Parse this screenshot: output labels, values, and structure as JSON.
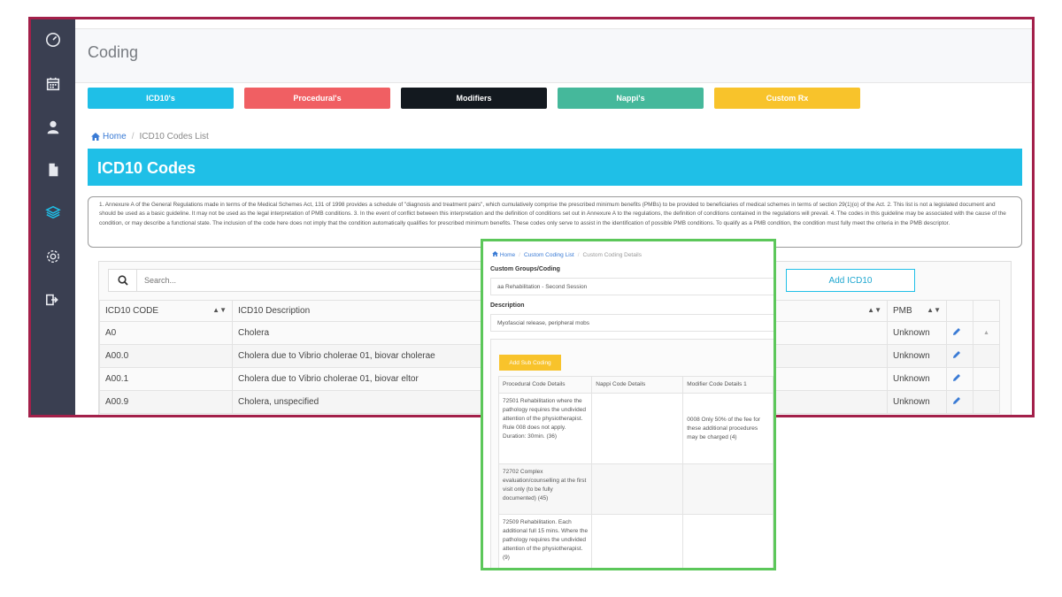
{
  "page": {
    "title": "Coding",
    "category_buttons": [
      {
        "label": "ICD10's",
        "color": "#1fbfe7"
      },
      {
        "label": "Procedural's",
        "color": "#f05f63"
      },
      {
        "label": "Modifiers",
        "color": "#13191f"
      },
      {
        "label": "Nappi's",
        "color": "#45b89b"
      },
      {
        "label": "Custom Rx",
        "color": "#f8c32b"
      }
    ],
    "breadcrumb": {
      "home": "Home",
      "current": "ICD10 Codes List"
    },
    "banner_title": "ICD10 Codes",
    "notice": "1. Annexure A of the General Regulations made in terms of the Medical Schemes Act, 131 of 1998 provides a schedule of \"diagnosis and treatment pairs\", which cumulatively comprise the prescribed minimum benefits (PMBs) to be provided to beneficiaries of medical schemes in terms of section 29(1)(o) of the Act. 2. This list is not a legislated document and should be used as a basic guideline. It may not be used as the legal interpretation of PMB conditions. 3. In the event of conflict between this interpretation and the definition of conditions set out in Annexure A to the regulations, the definition of conditions contained in the regulations will prevail. 4. The codes in this guideline may be associated with the cause of the condition, or may describe a functional state. The inclusion of the code here does not imply that the condition automatically qualifies for prescribed minimum benefits. These codes only serve to assist in the identification of possible PMB conditions. To qualify as a PMB condition, the condition must fully meet the criteria in the PMB descriptor.",
    "search_placeholder": "Search...",
    "add_button": "Add ICD10",
    "table": {
      "headers": {
        "code": "ICD10 CODE",
        "description": "ICD10 Description",
        "pmb": "PMB"
      },
      "rows": [
        {
          "code": "A0",
          "description": "Cholera",
          "pmb": "Unknown"
        },
        {
          "code": "A00.0",
          "description": "Cholera due to Vibrio cholerae 01, biovar cholerae",
          "pmb": "Unknown"
        },
        {
          "code": "A00.1",
          "description": "Cholera due to Vibrio cholerae 01, biovar eltor",
          "pmb": "Unknown"
        },
        {
          "code": "A00.9",
          "description": "Cholera, unspecified",
          "pmb": "Unknown"
        }
      ]
    }
  },
  "overlay": {
    "breadcrumb": {
      "home": "Home",
      "list": "Custom Coding List",
      "current": "Custom Coding Details"
    },
    "group_label": "Custom Groups/Coding",
    "group_value": "aa Rehabilitation - Second Session",
    "description_label": "Description",
    "description_value": "Myofascial release, peripheral mobs",
    "add_sub_button": "Add Sub Coding",
    "sub_table": {
      "headers": [
        "Procedural Code Details",
        "Nappi Code Details",
        "Modifier Code Details 1"
      ],
      "rows": [
        {
          "procedural": "72501 Rehabilitation where the pathology requires the undivided attention of the physiotherapist. Rule 008 does not apply. Duration: 30min. (36)",
          "nappi": "",
          "modifier": "0008 Only 50% of the fee for these additional procedures may be charged (4)"
        },
        {
          "procedural": "72702 Complex evaluation/counselling at the first visit only (to be fully documented) (45)",
          "nappi": "",
          "modifier": ""
        },
        {
          "procedural": "72509 Rehabilitation. Each additional full 15 mins. Where the pathology requires the undivided attention of the physiotherapist. (9)",
          "nappi": "",
          "modifier": ""
        }
      ]
    }
  },
  "colors": {
    "frame": "#a3204a",
    "overlay_frame": "#5cc75a",
    "sidebar": "#3a3f51",
    "accent": "#1fbfe7"
  }
}
